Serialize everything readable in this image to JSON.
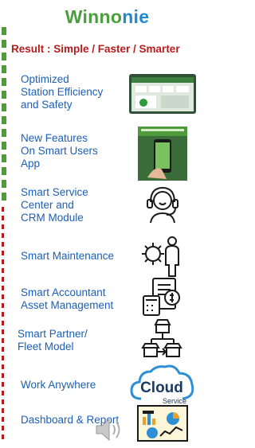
{
  "brand": {
    "part1": "Winno",
    "part2": "nie"
  },
  "tagline": "Result : Simple / Faster / Smarter",
  "items": [
    {
      "label_lines": [
        "Optimized",
        "Station Efficiency",
        "and Safety"
      ],
      "icon": "station-screenshot-icon"
    },
    {
      "label_lines": [
        "New Features",
        "On Smart Users",
        "App"
      ],
      "icon": "smartphone-app-icon"
    },
    {
      "label_lines": [
        "Smart Service",
        "Center and",
        "CRM Module"
      ],
      "icon": "headset-support-icon"
    },
    {
      "label_lines": [
        "Smart Maintenance"
      ],
      "icon": "maintenance-gear-person-icon"
    },
    {
      "label_lines": [
        "Smart Accountant",
        "Asset Management"
      ],
      "icon": "calculator-invoice-icon"
    },
    {
      "label_lines": [
        "Smart Partner/",
        "Fleet Model"
      ],
      "icon": "partner-network-icon"
    },
    {
      "label_lines": [
        "Work Anywhere"
      ],
      "icon": "cloud-service-icon"
    },
    {
      "label_lines": [
        "Dashboard & Report"
      ],
      "icon": "dashboard-chart-icon"
    }
  ],
  "cloud": {
    "title": "Cloud",
    "subtitle": "Service"
  },
  "colors": {
    "brand_green": "#4a9e3e",
    "brand_blue": "#1f8ad1",
    "tagline_red": "#b71c1c",
    "item_blue": "#1c5fb4"
  }
}
